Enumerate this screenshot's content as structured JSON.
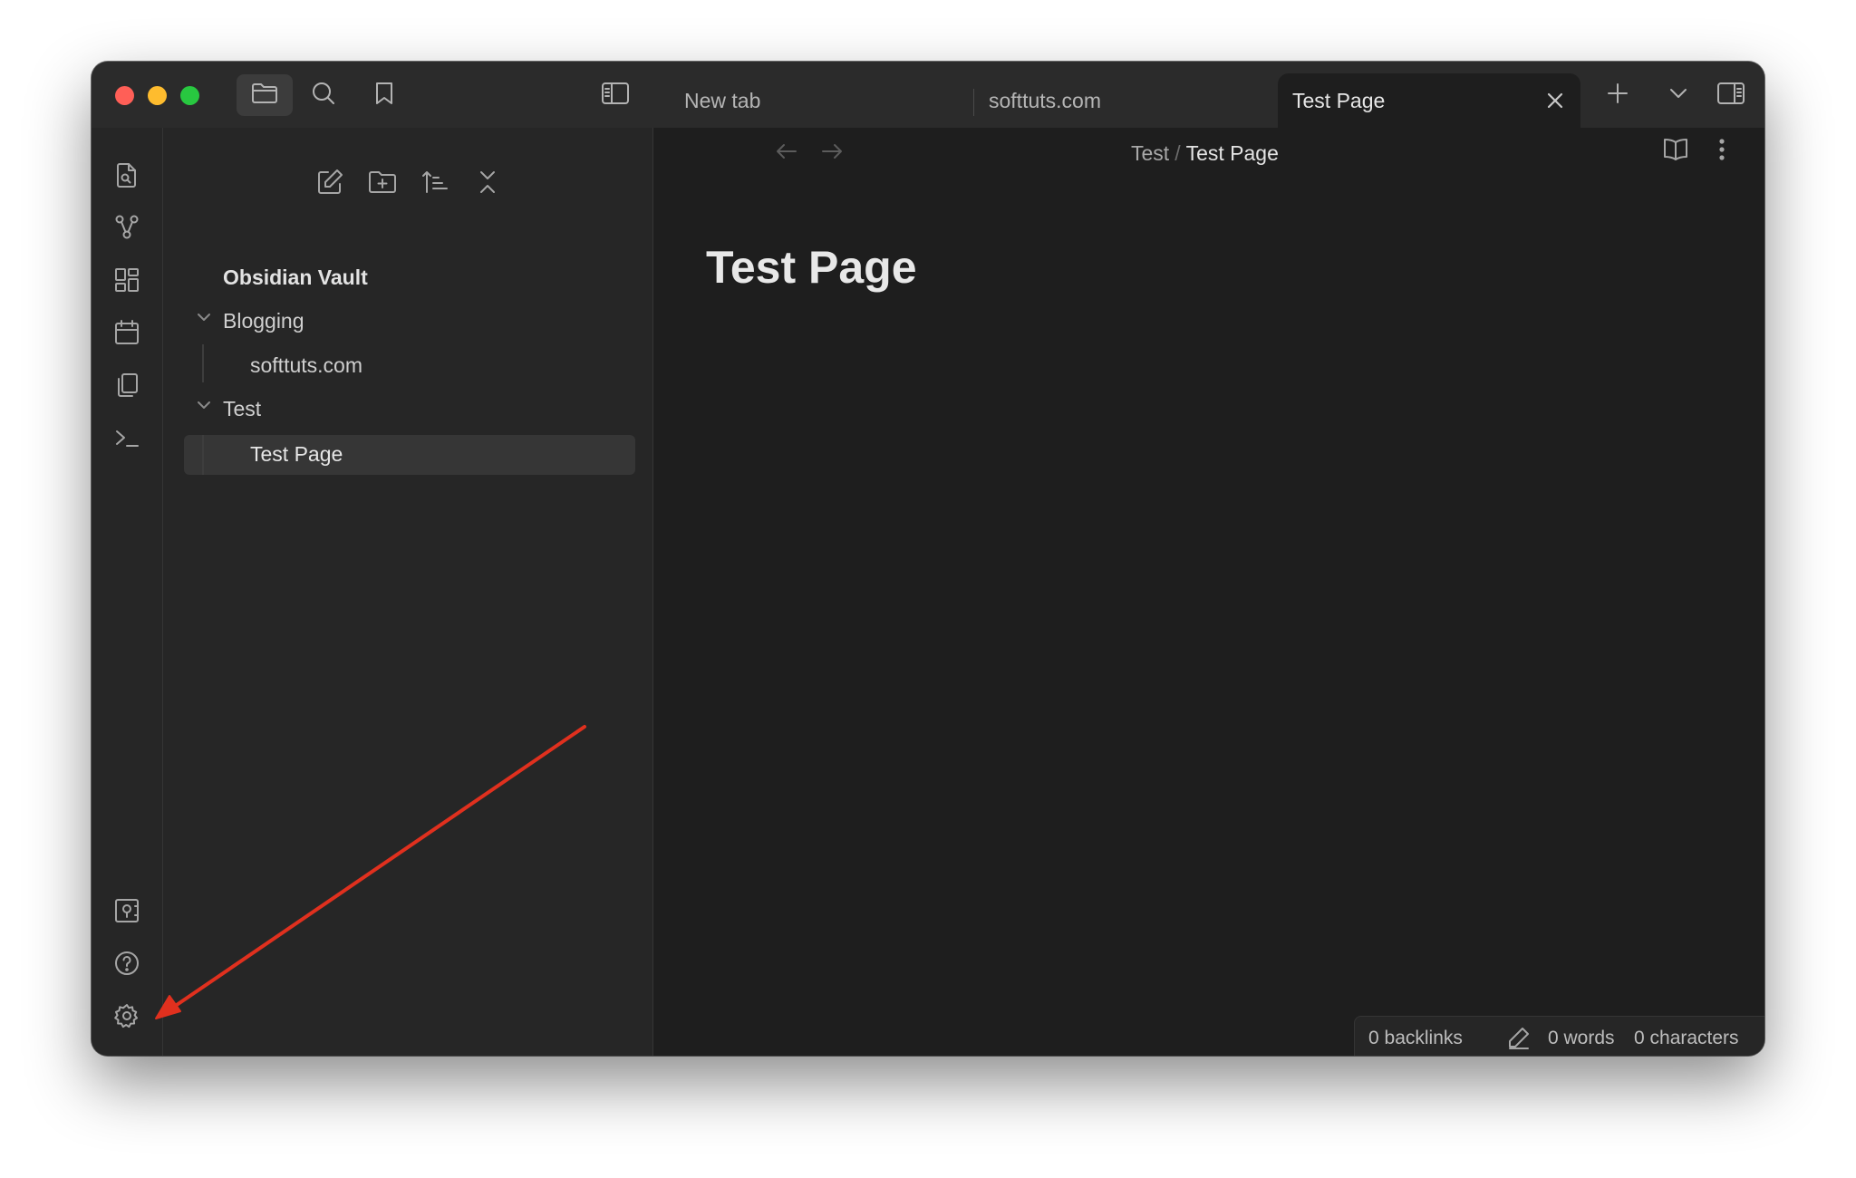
{
  "tabs": [
    {
      "label": "New tab",
      "active": false
    },
    {
      "label": "softtuts.com",
      "active": false
    },
    {
      "label": "Test Page",
      "active": true
    }
  ],
  "sidebar": {
    "vault_name": "Obsidian Vault",
    "folders": [
      {
        "name": "Blogging",
        "expanded": true,
        "files": [
          "softtuts.com"
        ]
      },
      {
        "name": "Test",
        "expanded": true,
        "files": [
          "Test Page"
        ]
      }
    ]
  },
  "breadcrumb": {
    "folder": "Test",
    "separator": "/",
    "current": "Test Page"
  },
  "note": {
    "title": "Test Page"
  },
  "status": {
    "backlinks": "0 backlinks",
    "words": "0 words",
    "characters": "0 characters"
  },
  "icons": {
    "titlebar": [
      "folder-icon",
      "search-icon",
      "bookmark-icon",
      "sidebar-toggle-icon"
    ],
    "ribbon_top": [
      "quick-switcher-icon",
      "graph-view-icon",
      "canvas-icon",
      "daily-note-icon",
      "templates-icon",
      "command-palette-icon"
    ],
    "ribbon_bottom": [
      "vault-icon",
      "help-icon",
      "settings-icon"
    ],
    "sidebar_tools": [
      "new-note-icon",
      "new-folder-icon",
      "sort-icon",
      "collapse-all-icon"
    ],
    "tab_controls": [
      "close-icon",
      "new-tab-icon",
      "tab-list-icon",
      "right-sidebar-icon"
    ]
  },
  "colors": {
    "window_bg": "#1e1e1e",
    "sidebar_bg": "#262626",
    "titlebar_bg": "#2b2b2b",
    "annotation_arrow": "#e0301e"
  }
}
